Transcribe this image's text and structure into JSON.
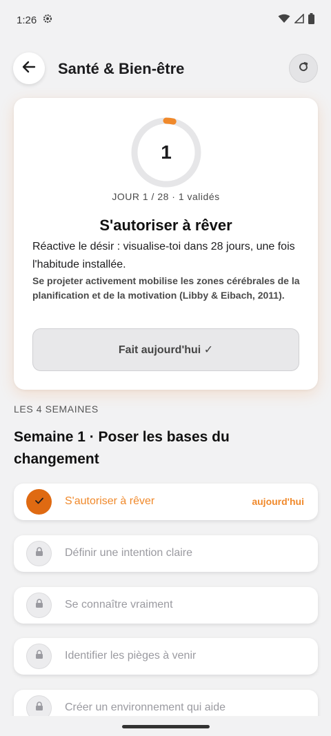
{
  "status_bar": {
    "time": "1:26",
    "icons": [
      "settings-gear-icon",
      "wifi-icon",
      "signal-icon",
      "battery-icon"
    ]
  },
  "header": {
    "title": "Santé & Bien-être",
    "back_icon": "arrow-left-icon",
    "refresh_icon": "refresh-icon"
  },
  "today_card": {
    "progress_number": "1",
    "progress_fraction": 0.0357,
    "day_label": "JOUR 1 / 28 · 1 validés",
    "title": "S'autoriser à rêver",
    "description": "Réactive le désir : visualise-toi dans 28 jours, une fois l'habitude installée.",
    "note": "Se projeter activement mobilise les zones cérébrales de la planification et de la motivation (Libby & Eibach, 2011).",
    "done_button": "Fait aujourd'hui ✓"
  },
  "weeks": {
    "section_label": "LES 4 SEMAINES",
    "week_title": "Semaine 1 · Poser les bases du changement",
    "today_tag": "aujourd'hui",
    "items": [
      {
        "label": "S'autoriser à rêver",
        "state": "done"
      },
      {
        "label": "Définir une intention claire",
        "state": "locked"
      },
      {
        "label": "Se connaître vraiment",
        "state": "locked"
      },
      {
        "label": "Identifier les pièges à venir",
        "state": "locked"
      },
      {
        "label": "Créer un environnement qui aide",
        "state": "locked"
      }
    ]
  },
  "colors": {
    "accent": "#f0892b",
    "accent_dark": "#df6a12",
    "locked_text": "#9a9aa0",
    "background": "#f2f2f3"
  }
}
